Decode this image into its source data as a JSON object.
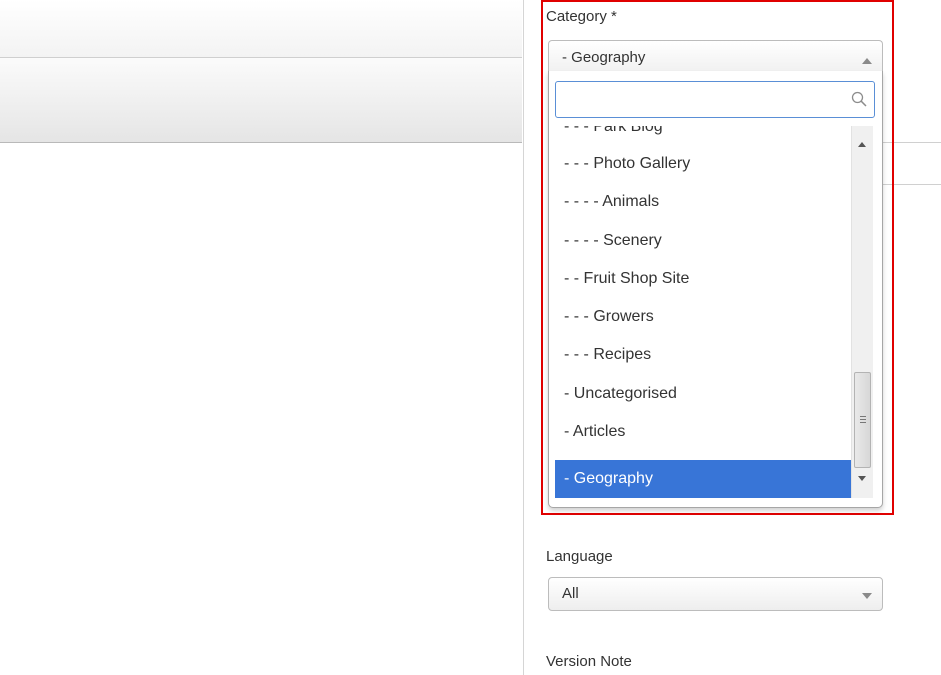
{
  "category": {
    "label": "Category *",
    "selected_value": "- Geography",
    "search_placeholder": "",
    "options": [
      "- - - Park Blog",
      "- - - Photo Gallery",
      "- - - - Animals",
      "- - - - Scenery",
      "- - Fruit Shop Site",
      "- - - Growers",
      "- - - Recipes",
      "- Uncategorised",
      "- Articles",
      "- Geography"
    ],
    "highlighted_option": "- Geography"
  },
  "language": {
    "label": "Language",
    "selected_value": "All"
  },
  "version_note": {
    "label": "Version Note"
  },
  "colors": {
    "highlight_border": "#e00000",
    "selected_option_bg": "#3875d7",
    "search_focus_border": "#5a8fd6"
  }
}
